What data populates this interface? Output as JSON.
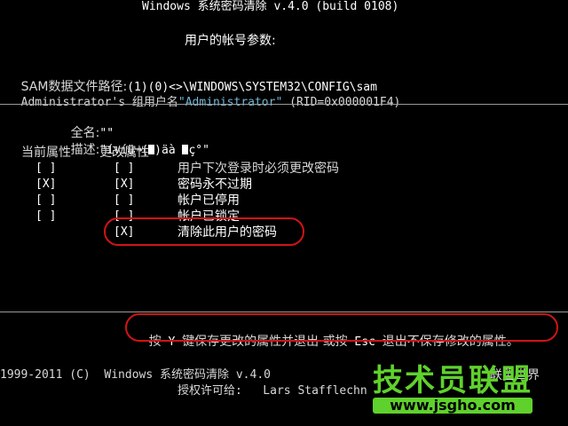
{
  "title": "Windows 系统密码清除 v.4.0 (build 0108)",
  "params_heading": "用户的帐号参数:",
  "sam_path_label": "SAM数据文件路径:",
  "sam_path_value": "(1)(0)<>\\WINDOWS\\SYSTEM32\\CONFIG\\sam",
  "group": {
    "prefix": "Administrator's 组用户名",
    "name": "\"Administrator\"",
    "suffix": " (RID=0x000001F4)"
  },
  "fullname": {
    "label": "全名:",
    "value": "\"\""
  },
  "description": {
    "label": "描述:",
    "value": "\"ívíü¬(",
    "value_end": ")äà",
    "value_tail": "ç°\""
  },
  "headers": {
    "current": "当前属性",
    "change": "更改属性"
  },
  "attributes": [
    {
      "current": "[ ]",
      "change": "[ ]",
      "label": "用户下次登录时必须更改密码"
    },
    {
      "current": "[X]",
      "change": "[X]",
      "label": "密码永不过期"
    },
    {
      "current": "[ ]",
      "change": "[ ]",
      "label": "帐户已停用"
    },
    {
      "current": "[ ]",
      "change": "[ ]",
      "label": "帐户已锁定"
    },
    {
      "current": "",
      "change": "[X]",
      "label": "清除此用户的密码"
    }
  ],
  "footer_help": {
    "a": "按",
    "key_y": "Y",
    "b": "键保存更改的属性并退出 或按",
    "key_esc": "Esc",
    "c": "退出不保存修改的属性。"
  },
  "copyright": "1999-2011 (C)  Windows 系统密码清除 v.4.0",
  "copyright_tail": "联盟世界",
  "license": "授权许可给:   Lars Stafflechn",
  "watermark": {
    "brand": "技术员联盟",
    "url": "www.jsgho.com"
  },
  "colors": {
    "highlight": "#74b6d6",
    "annotation": "#d21414",
    "watermark": "#5fd12c"
  }
}
